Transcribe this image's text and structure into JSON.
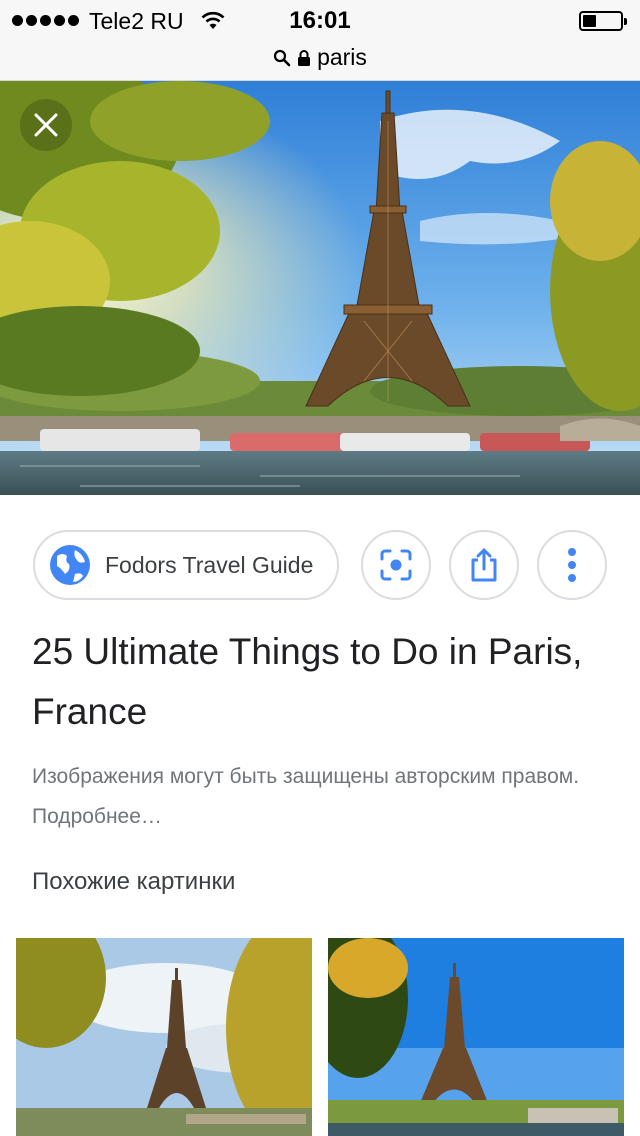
{
  "status_bar": {
    "carrier": "Tele2 RU",
    "time": "16:01",
    "battery_level": 0.35
  },
  "url_bar": {
    "url": "paris",
    "icons": [
      "search-icon",
      "lock-icon"
    ]
  },
  "hero": {
    "image": "eiffel-tower-photo",
    "close_icon": "close-icon"
  },
  "actions": {
    "source_label": "Fodors Travel Guide",
    "source_icon": "globe-icon",
    "lens_icon": "lens-icon",
    "share_icon": "share-icon",
    "more_icon": "more-vertical-icon"
  },
  "result": {
    "title": "25 Ultimate Things to Do in Paris, France",
    "copyright_note": "Изображения могут быть защищены авторским правом. Подробнее…"
  },
  "similar": {
    "heading": "Похожие картинки",
    "thumbnails": [
      "eiffel-tower-thumb-1",
      "eiffel-tower-thumb-2"
    ]
  },
  "colors": {
    "accent": "#4285f4",
    "border": "#dadce0",
    "title": "#202124",
    "secondary_text": "#70757a"
  }
}
